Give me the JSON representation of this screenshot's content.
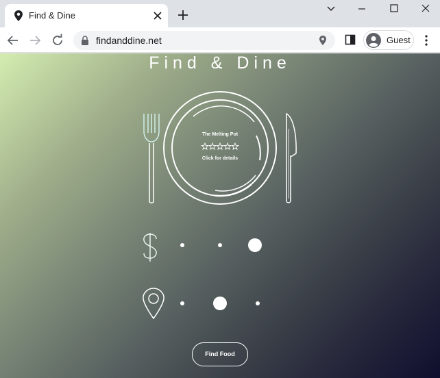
{
  "browser": {
    "tab": {
      "title": "Find & Dine"
    },
    "address": {
      "url": "findanddine.net"
    },
    "profile": {
      "label": "Guest"
    }
  },
  "page": {
    "title": "Find & Dine",
    "plate": {
      "restaurant_name": "The Melting Pot",
      "rating_stars": 5,
      "details_text": "Click for details"
    },
    "price_selector": {
      "icon": "dollar-icon",
      "options": 3,
      "selected_index": 2
    },
    "distance_selector": {
      "icon": "location-pin-icon",
      "options": 3,
      "selected_index": 1
    },
    "find_button": "Find Food"
  },
  "colors": {
    "accent": "#ffffff",
    "fork_tint": "#cfeee8"
  }
}
